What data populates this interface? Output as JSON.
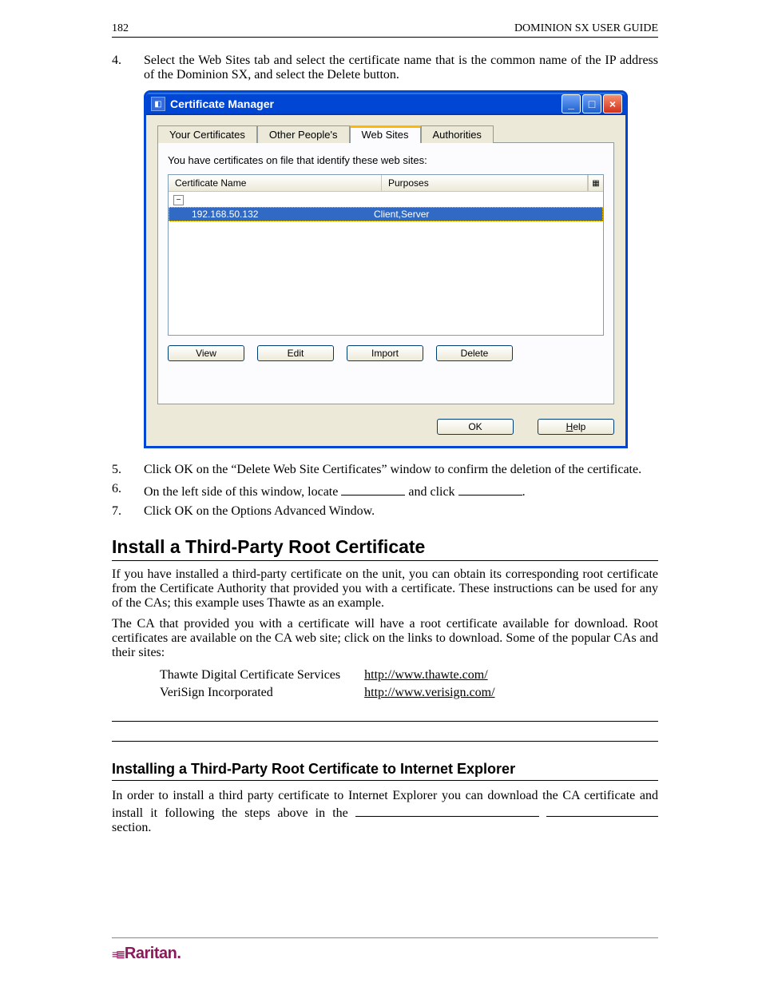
{
  "header": {
    "page_num": "182",
    "guide": "DOMINION SX USER GUIDE"
  },
  "steps": {
    "s4": {
      "num": "4.",
      "text": "Select the Web Sites tab and select the certificate name that is the common name of the IP address of the Dominion SX, and select the Delete button."
    },
    "s5": {
      "num": "5.",
      "text": "Click OK on the “Delete Web Site Certificates” window to confirm the deletion of the certificate."
    },
    "s6": {
      "num": "6.",
      "pre": "On the left side of this window, locate ",
      "mid": " and click ",
      "post": "."
    },
    "s7": {
      "num": "7.",
      "text": "Click OK on the Options Advanced Window."
    }
  },
  "win": {
    "title": "Certificate Manager",
    "tabs": [
      "Your Certificates",
      "Other People's",
      "Web Sites",
      "Authorities"
    ],
    "desc": "You have certificates on file that identify these web sites:",
    "cols": {
      "c1": "Certificate Name",
      "c2": "Purposes"
    },
    "row": {
      "name": "192.168.50.132",
      "purpose": "Client,Server"
    },
    "buttons": {
      "view": "View",
      "edit": "Edit",
      "import": "Import",
      "delete": "Delete",
      "ok": "OK",
      "help_h": "H",
      "help_rest": "elp"
    }
  },
  "sect": {
    "h2": "Install a Third-Party Root Certificate",
    "p1": "If you have installed a third-party certificate on the unit, you can obtain its corresponding root certificate from the Certificate Authority that provided you with a certificate. These instructions can be used for any of the CAs; this example uses Thawte as an example.",
    "p2": "The CA that provided you with a certificate will have a root certificate available for download. Root certificates are available on the CA web site; click on the links to download. Some of the popular CAs and their sites:",
    "ca1": {
      "name": "Thawte Digital Certificate Services",
      "url": "http://www.thawte.com/"
    },
    "ca2": {
      "name": "VeriSign Incorporated",
      "url": "http://www.verisign.com/"
    },
    "h3": "Installing a Third-Party Root Certificate to Internet Explorer",
    "p3a": "In order to install a third party certificate to Internet Explorer you can download the CA certificate and install it following the steps above in the ",
    "p3b": " section."
  },
  "footer": {
    "brand": "Raritan."
  }
}
